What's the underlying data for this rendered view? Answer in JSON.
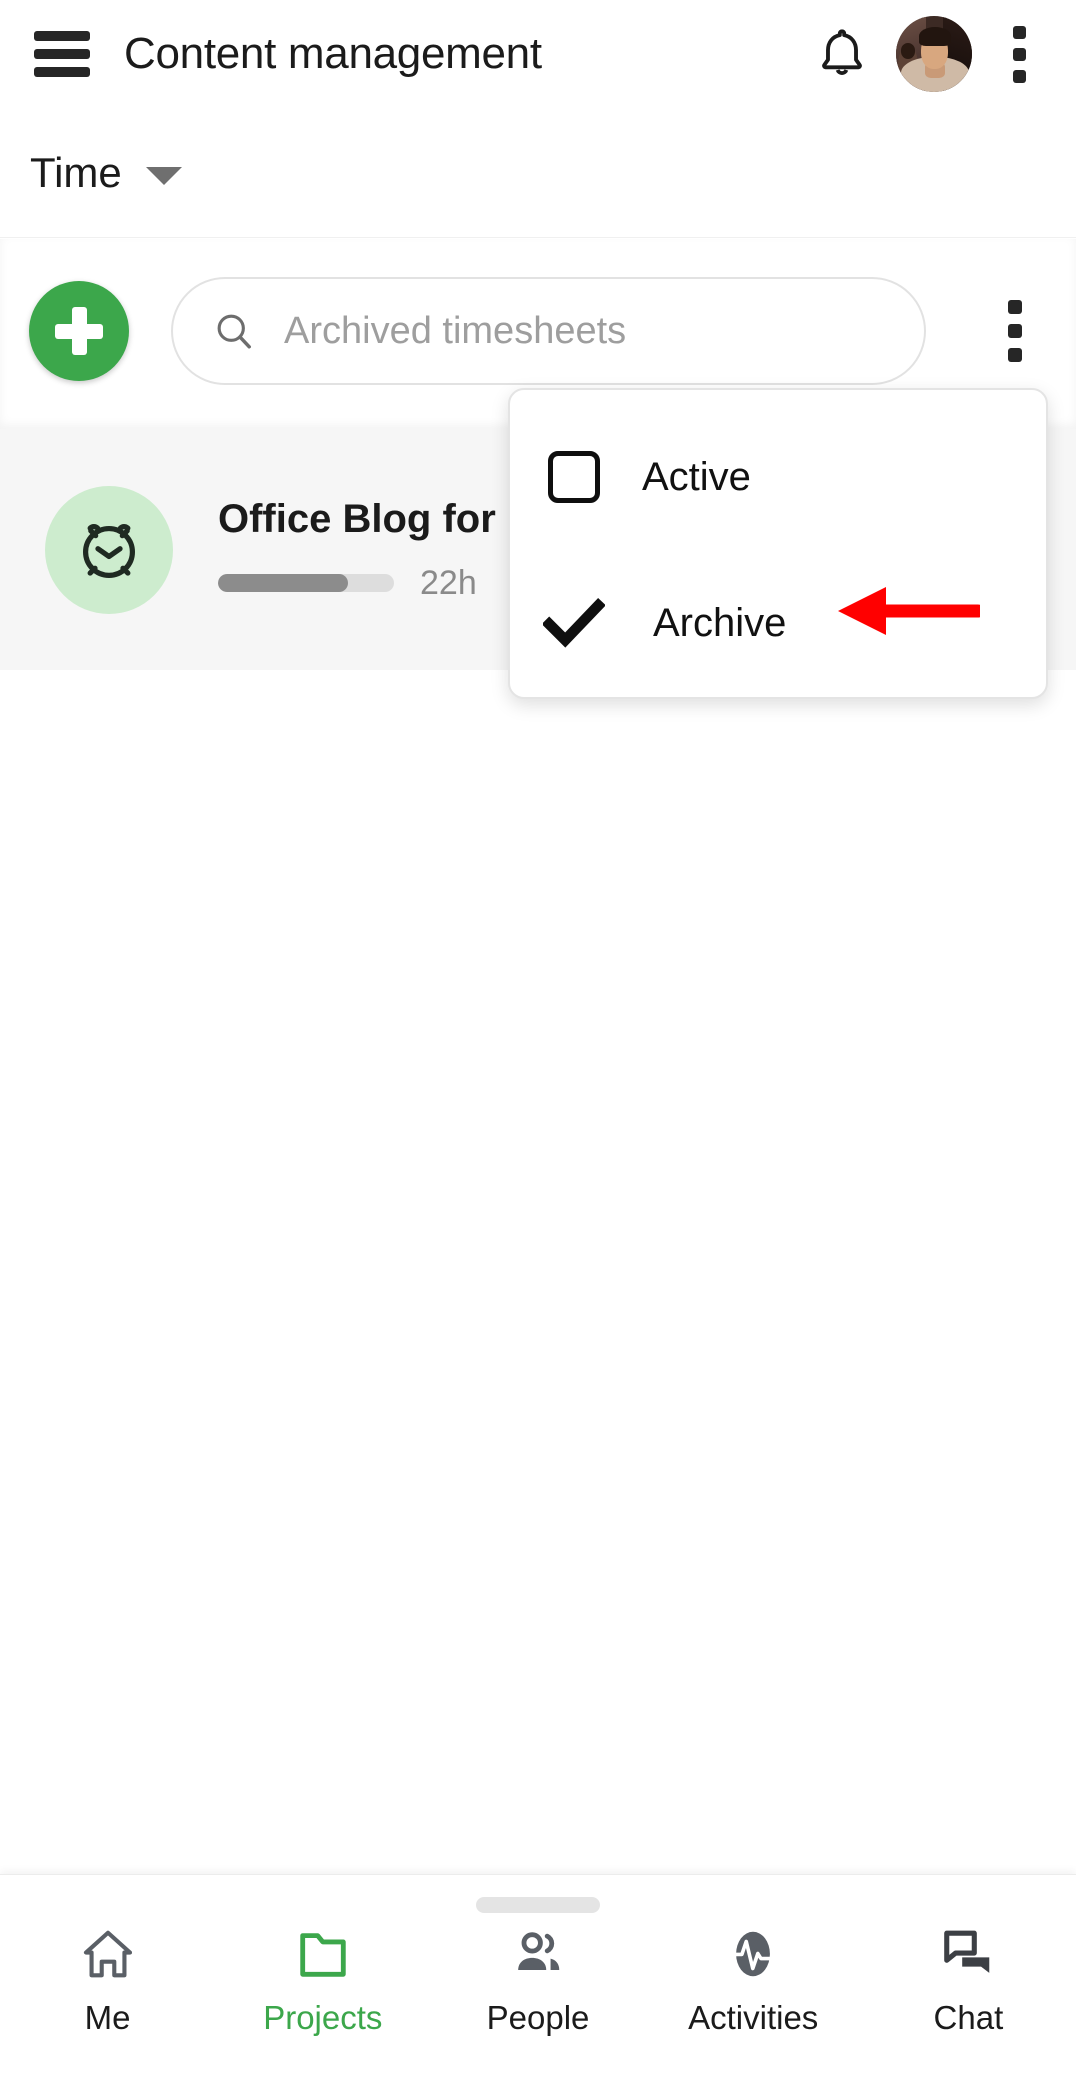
{
  "appbar": {
    "menu_icon": "hamburger-icon",
    "title": "Content management",
    "bell_icon": "notification-bell-icon",
    "avatar_alt": "user-avatar",
    "overflow_icon": "more-vertical-icon"
  },
  "subbar": {
    "selected": "Time",
    "caret_icon": "chevron-down-icon"
  },
  "toolbar": {
    "add_icon": "plus-icon",
    "search_icon": "search-icon",
    "search_value": "",
    "search_placeholder": "Archived timesheets",
    "overflow_icon": "more-vertical-icon"
  },
  "dropdown": {
    "items": [
      {
        "label": "Active",
        "checked": false,
        "icon": "empty-checkbox-icon"
      },
      {
        "label": "Archive",
        "checked": true,
        "icon": "checkmark-icon"
      }
    ]
  },
  "annotation": {
    "arrow_color": "#ff0000",
    "points_to": "Archive"
  },
  "list": {
    "items": [
      {
        "icon": "alarm-clock-icon",
        "title": "Office Blog for",
        "progress_percent": 74,
        "hours": "22h",
        "accent_bg": "#cdecce"
      }
    ]
  },
  "bottom_nav": {
    "handle": "drag-handle",
    "items": [
      {
        "label": "Me",
        "icon": "home-icon",
        "active": false
      },
      {
        "label": "Projects",
        "icon": "folder-icon",
        "active": true
      },
      {
        "label": "People",
        "icon": "people-icon",
        "active": false
      },
      {
        "label": "Activities",
        "icon": "pulse-icon",
        "active": false
      },
      {
        "label": "Chat",
        "icon": "chat-icon",
        "active": false
      }
    ]
  },
  "colors": {
    "brand_green": "#3ca74b",
    "light_green": "#cdecce",
    "list_bg": "#f6f6f6",
    "text": "#1b1b1b",
    "muted": "#8a8a8a",
    "accent_red": "#ff0000"
  }
}
